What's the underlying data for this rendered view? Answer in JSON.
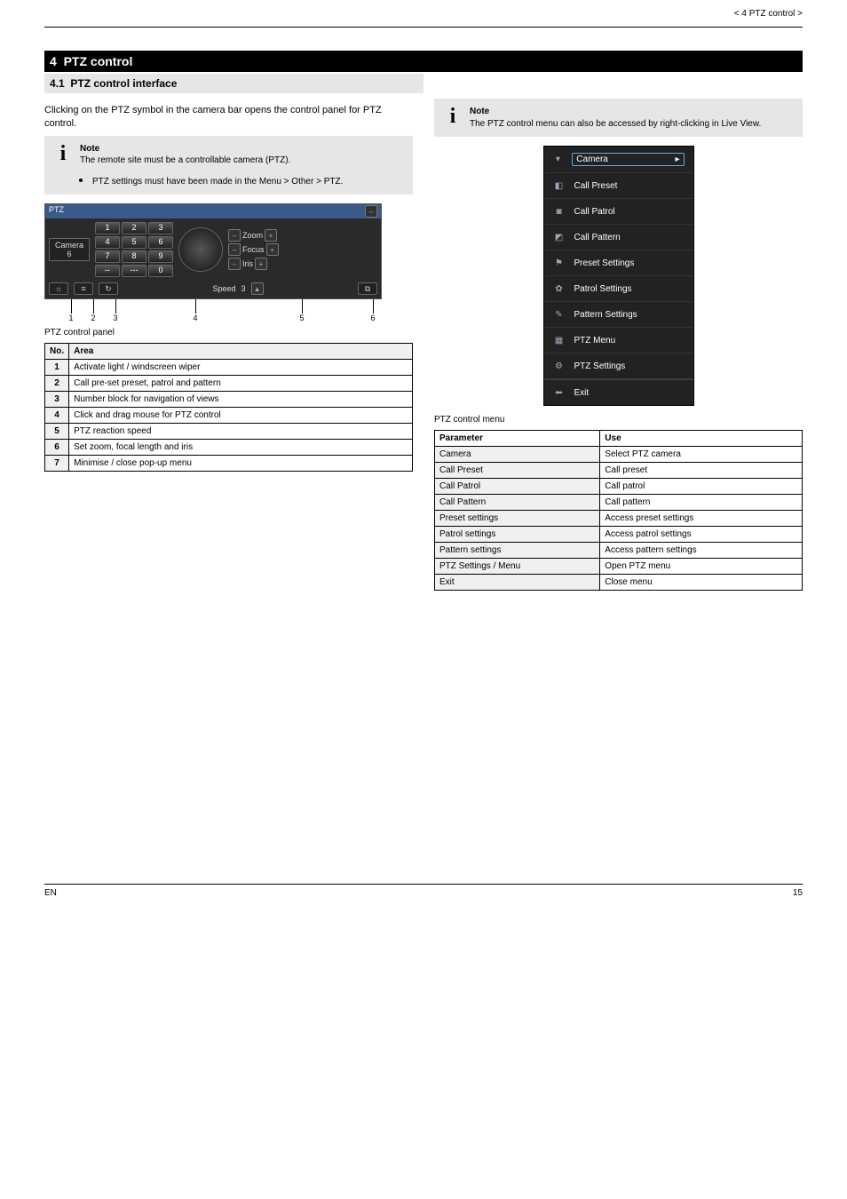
{
  "header": {
    "right": "< 4 PTZ control >"
  },
  "chapter": {
    "num": "4",
    "title": "PTZ control"
  },
  "section": {
    "num": "4.1",
    "title": "PTZ control interface"
  },
  "col1": {
    "intro": "Clicking on the PTZ symbol in the camera bar opens the control panel for PTZ control.",
    "info": {
      "heading": "Note",
      "line1": "The remote site must be a controllable camera (PTZ).",
      "bullet": "PTZ settings must have been made in the Menu > Other > PTZ."
    },
    "fig_title": "PTZ control panel",
    "ptz": {
      "title": "PTZ",
      "camera_label": "Camera",
      "camera_num": "6",
      "keys": [
        "1",
        "2",
        "3",
        "4",
        "5",
        "6",
        "7",
        "8",
        "9",
        "--",
        "---",
        "0"
      ],
      "zoom": "Zoom",
      "focus": "Focus",
      "iris": "Iris",
      "speed": "Speed",
      "speed_val": "3"
    },
    "callouts": {
      "c1": "1",
      "c2": "2",
      "c3": "3",
      "c4": "4",
      "c5": "5",
      "c6": "6"
    },
    "table_heading": {
      "no": "No.",
      "area": "Area"
    },
    "table": [
      {
        "no": "1",
        "area": "Activate light / windscreen wiper"
      },
      {
        "no": "2",
        "area": "Call pre-set preset, patrol and pattern"
      },
      {
        "no": "3",
        "area": "Number block for navigation of views"
      },
      {
        "no": "4",
        "area": "Click and drag mouse for PTZ control"
      },
      {
        "no": "5",
        "area": "PTZ reaction speed"
      },
      {
        "no": "6",
        "area": "Set zoom, focal length and iris"
      },
      {
        "no": "7",
        "area": "Minimise / close pop-up menu"
      }
    ]
  },
  "col2": {
    "info": {
      "heading": "Note",
      "body": "The PTZ control menu can also be accessed by right-clicking in Live View."
    },
    "ctx_title": "PTZ control menu",
    "ctx_items": {
      "camera": "Camera",
      "call_preset": "Call Preset",
      "call_patrol": "Call Patrol",
      "call_pattern": "Call Pattern",
      "preset_settings": "Preset Settings",
      "patrol_settings": "Patrol Settings",
      "pattern_settings": "Pattern Settings",
      "ptz_menu": "PTZ Menu",
      "ptz_settings": "PTZ Settings",
      "exit": "Exit"
    },
    "menu_heading": {
      "param": "Parameter",
      "use": "Use"
    },
    "menu": [
      {
        "k": "Camera",
        "v": "Select PTZ camera"
      },
      {
        "k": "Call Preset",
        "v": "Call preset"
      },
      {
        "k": "Call Patrol",
        "v": "Call patrol"
      },
      {
        "k": "Call Pattern",
        "v": "Call pattern"
      },
      {
        "k": "Preset settings",
        "v": "Access preset settings"
      },
      {
        "k": "Patrol settings",
        "v": "Access patrol settings"
      },
      {
        "k": "Pattern settings",
        "v": "Access pattern settings"
      },
      {
        "k": "PTZ Settings / Menu",
        "v": "Open PTZ menu"
      },
      {
        "k": "Exit",
        "v": "Close menu"
      }
    ]
  },
  "footer": {
    "left": "EN",
    "right": "15"
  }
}
